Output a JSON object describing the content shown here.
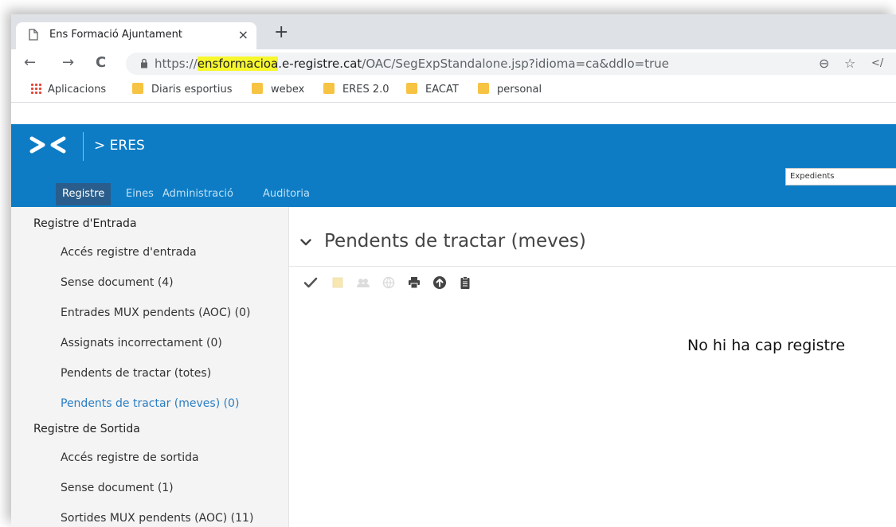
{
  "browser": {
    "tab": {
      "title": "Ens Formació Ajuntament",
      "close": "×"
    },
    "new_tab": "+",
    "nav": {
      "back": "←",
      "forward": "→",
      "reload": "C"
    },
    "url": {
      "scheme": "https://",
      "highlight": "ensformacioa",
      "host_rest": ".e-registre.cat",
      "path": "/OAC/SegExpStandalone.jsp?idioma=ca&ddlo=true"
    },
    "omnibox_icons": {
      "zoom": "⊖",
      "star": "☆",
      "code": "</"
    },
    "bookmarks": [
      {
        "label": "Aplicacions"
      },
      {
        "label": "Diaris esportius"
      },
      {
        "label": "webex"
      },
      {
        "label": "ERES 2.0"
      },
      {
        "label": "EACAT"
      },
      {
        "label": "personal"
      }
    ]
  },
  "app": {
    "breadcrumb": "> ERES",
    "search_placeholder": "Expedients",
    "menu": [
      {
        "label": "Registre",
        "active": true
      },
      {
        "label": "Eines"
      },
      {
        "label": "Administració"
      },
      {
        "label": "Auditoria"
      }
    ],
    "colors": {
      "header": "#0e7cc5",
      "active_menu": "#2a5d8b",
      "link_active": "#2a7ec3"
    }
  },
  "sidebar": {
    "entrada": {
      "heading": "Registre d'Entrada",
      "items": [
        "Accés registre d'entrada",
        "Sense document (4)",
        "Entrades MUX pendents (AOC) (0)",
        "Assignats incorrectament (0)",
        "Pendents de tractar (totes)",
        "Pendents de tractar (meves) (0)"
      ]
    },
    "sortida": {
      "heading": "Registre de Sortida",
      "items": [
        "Accés registre de sortida",
        "Sense document (1)",
        "Sortides MUX pendents (AOC) (11)"
      ]
    }
  },
  "main": {
    "title": "Pendents de tractar (meves)",
    "toolbar_icons": [
      "check-icon",
      "note-icon",
      "group-icon",
      "globe-icon",
      "print-icon",
      "upload-icon",
      "clipboard-icon"
    ],
    "empty_message": "No hi ha cap registre"
  }
}
